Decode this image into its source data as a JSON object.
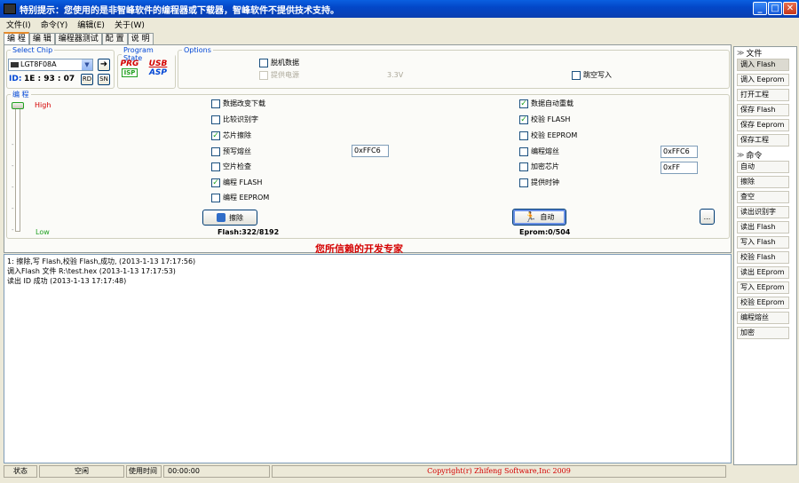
{
  "window": {
    "title": "特别提示：您使用的是非智峰软件的编程器或下载器，智峰软件不提供技术支持。",
    "buttons": {
      "min": "_",
      "max": "□",
      "close": "✕"
    }
  },
  "menu": [
    "文件(I)",
    "命令(Y)",
    "编辑(E)",
    "关于(W)"
  ],
  "tabs": [
    "编 程",
    "编 辑",
    "编程器测试",
    "配 置",
    "说 明"
  ],
  "select_chip": {
    "legend": "Select Chip",
    "value": "LGT8F08A",
    "id_label": "ID:",
    "id_value": "1E : 93 : 07",
    "rd": "RD",
    "sn": "SN"
  },
  "program_state": {
    "legend": "Program State",
    "prg": "PRG",
    "isp": "ISP",
    "usb": "USB",
    "asp": "ASP"
  },
  "options": {
    "legend": "Options",
    "offline": "脱机数据",
    "power": "提供电源",
    "voltage": "3.3V",
    "skip_empty": "跳空写入"
  },
  "program": {
    "legend": "编 程",
    "high": "High",
    "low": "Low",
    "left": [
      {
        "label": "数据改变下载",
        "checked": false
      },
      {
        "label": "比较识别字",
        "checked": false
      },
      {
        "label": "芯片擦除",
        "checked": true
      },
      {
        "label": "预写熔丝",
        "checked": false
      },
      {
        "label": "空片检查",
        "checked": false
      },
      {
        "label": "编程 FLASH",
        "checked": true
      },
      {
        "label": "编程 EEPROM",
        "checked": false
      }
    ],
    "right": [
      {
        "label": "数据自动重载",
        "checked": true
      },
      {
        "label": "校验 FLASH",
        "checked": true
      },
      {
        "label": "校验 EEPROM",
        "checked": false
      },
      {
        "label": "编程熔丝",
        "checked": false
      },
      {
        "label": "加密芯片",
        "checked": false
      },
      {
        "label": "提供时钟",
        "checked": false
      }
    ],
    "prefuse_value": "0xFFC6",
    "fuse_value": "0xFFC6",
    "lock_value": "0xFF",
    "erase_button": "擦除",
    "auto_button": "自动",
    "more_button": "...",
    "flash_info": "Flash:322/8192",
    "eprom_info": "Eprom:0/504",
    "slogan": "您所信赖的开发专家"
  },
  "log": [
    "1: 擦除,写 Flash,校验 Flash,成功, (2013-1-13 17:17:56)",
    "调入Flash 文件 R:\\test.hex (2013-1-13 17:17:53)",
    "读出 ID 成功 (2013-1-13 17:17:48)"
  ],
  "status": {
    "state_label": "状态",
    "state_value": "空闲",
    "time_label": "使用时间",
    "time_value": "00:00:00",
    "copyright": "Copyright(r) Zhifeng Software,Inc 2009"
  },
  "sidebar": {
    "file_title": "文件",
    "file_items": [
      "调入 Flash",
      "调入 Eeprom",
      "打开工程",
      "保存 Flash",
      "保存 Eeprom",
      "保存工程"
    ],
    "cmd_title": "命令",
    "cmd_items": [
      "自动",
      "擦除",
      "查空",
      "读出识别字",
      "读出 Flash",
      "写入 Flash",
      "校验 Flash",
      "读出 EEprom",
      "写入 EEprom",
      "校验 EEprom",
      "编程熔丝",
      "加密"
    ]
  },
  "colors": {
    "accent": "#0046d5",
    "slogan": "#d40000",
    "check": "#21a121",
    "titlebar": "#0347c8"
  }
}
